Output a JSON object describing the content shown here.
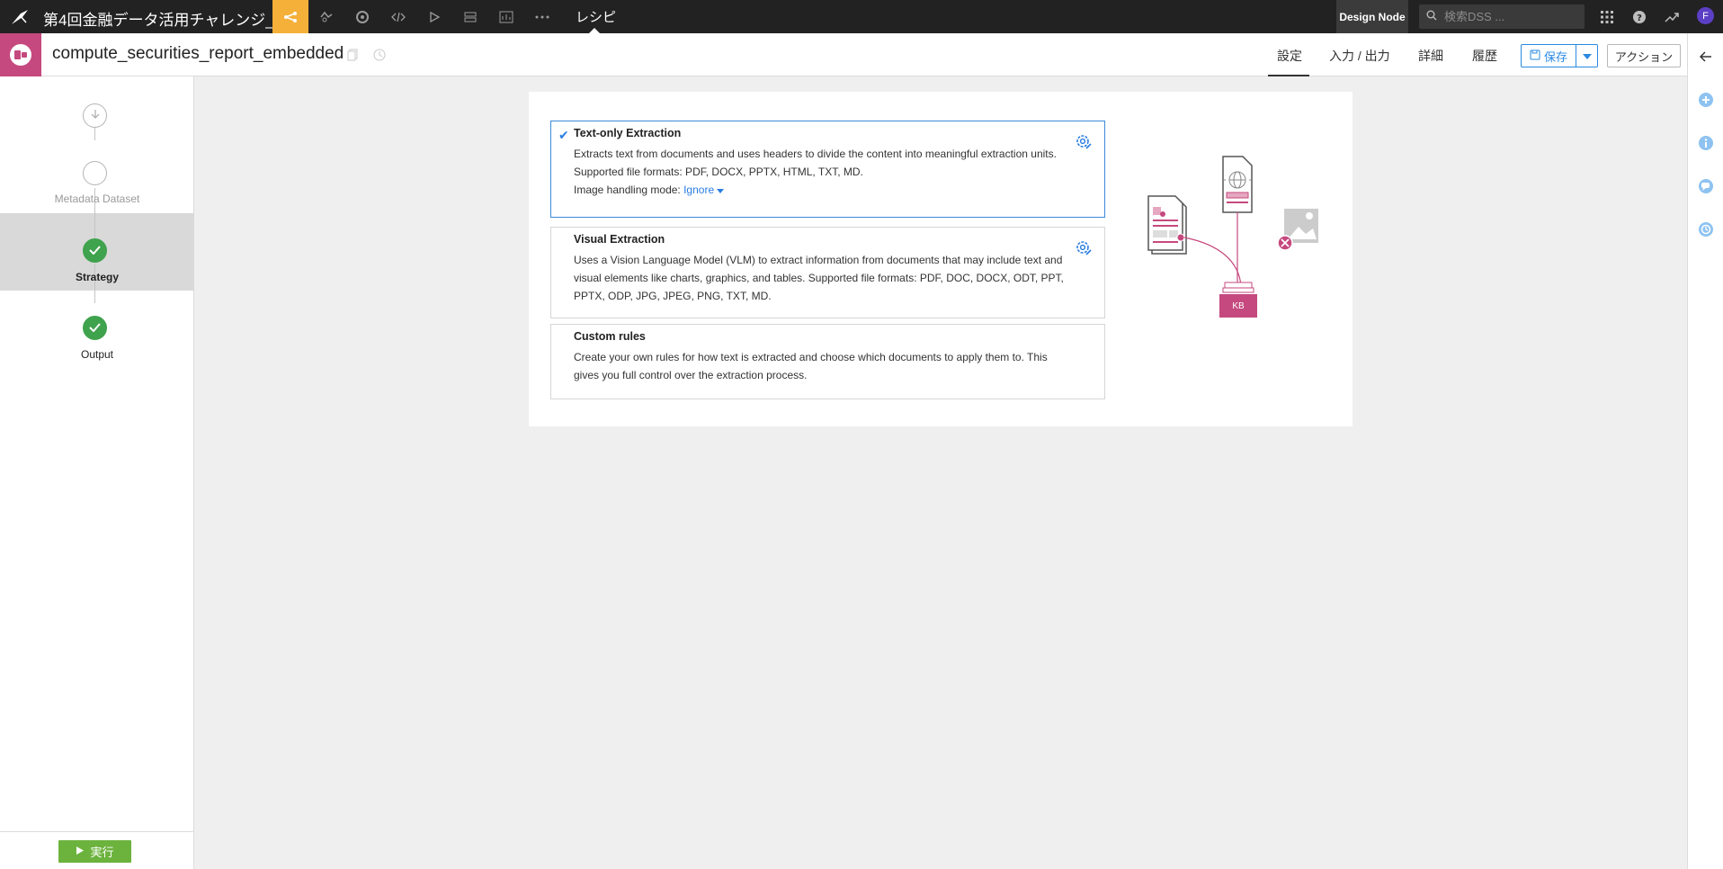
{
  "topbar": {
    "project_title": "第4回金融データ活用チャレンジ_",
    "recipe_tab": "レシピ",
    "node_label": "Design Node",
    "search_placeholder": "検索DSS ...",
    "avatar_initial": "F",
    "nav_icons": [
      "flow-icon",
      "lab-icon",
      "deploy-icon",
      "code-icon",
      "run-icon",
      "stack-icon",
      "dashboard-icon",
      "more-icon"
    ]
  },
  "header": {
    "recipe_name": "compute_securities_report_embedded",
    "tabs": [
      "設定",
      "入力 / 出力",
      "詳細",
      "履歴"
    ],
    "active_tab": "設定",
    "save_label": "保存",
    "action_label": "アクション"
  },
  "sidebar": {
    "steps": [
      {
        "label": "",
        "state": "input"
      },
      {
        "label": "Metadata Dataset",
        "state": "empty"
      },
      {
        "label": "Strategy",
        "state": "done-active"
      },
      {
        "label": "Output",
        "state": "done"
      }
    ],
    "run_label": "実行"
  },
  "options": [
    {
      "title": "Text-only Extraction",
      "desc": "Extracts text from documents and uses headers to divide the content into meaningful extraction units. Supported file formats: PDF, DOCX, PPTX, HTML, TXT, MD.",
      "selected": true,
      "image_mode_label": "Image handling mode:",
      "image_mode_value": "Ignore"
    },
    {
      "title": "Visual Extraction",
      "desc": "Uses a Vision Language Model (VLM) to extract information from documents that may include text and visual elements like charts, graphics, and tables. Supported file formats: PDF, DOC, DOCX, ODT, PPT, PPTX, ODP, JPG, JPEG, PNG, TXT, MD.",
      "selected": false
    },
    {
      "title": "Custom rules",
      "desc": "Create your own rules for how text is extracted and choose which documents to apply them to. This gives you full control over the extraction process.",
      "selected": false
    }
  ],
  "illustration": {
    "kb_label": "KB"
  },
  "colors": {
    "accent": "#2a7de1",
    "recipe": "#c5497e",
    "flow_active": "#f5b03a",
    "success": "#3fa34d",
    "run_button": "#6cb33e"
  }
}
